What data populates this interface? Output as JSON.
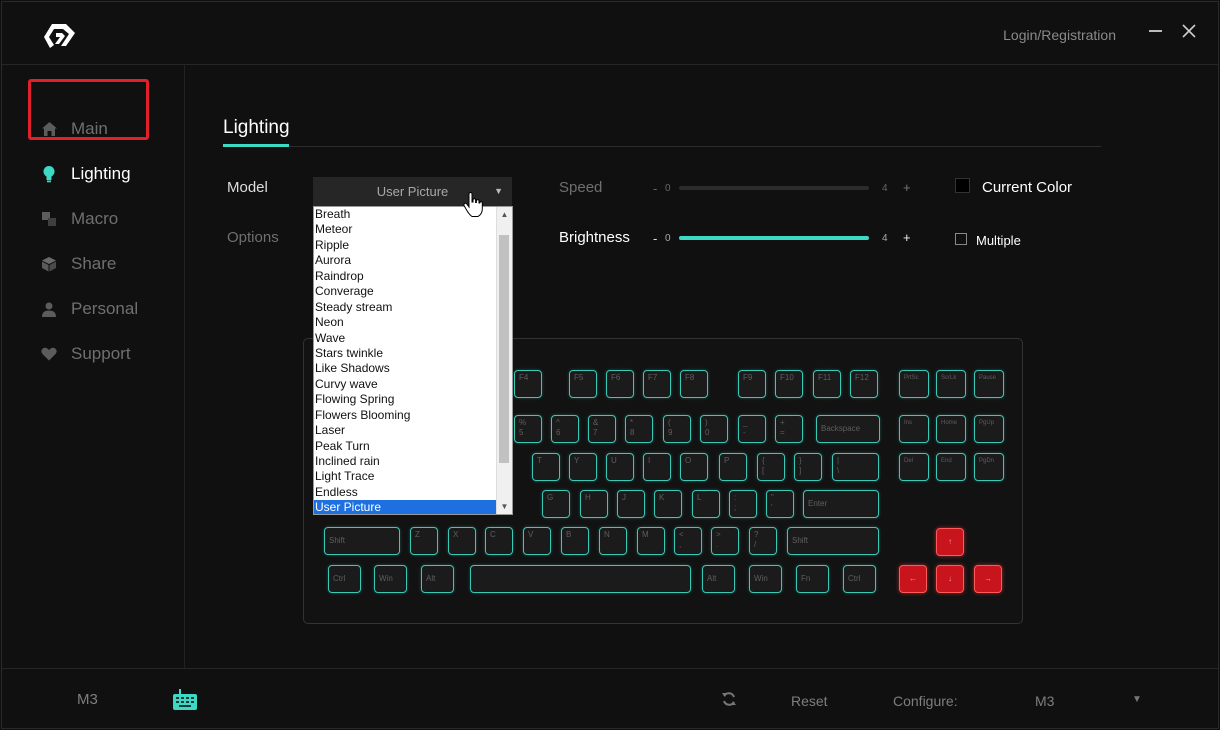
{
  "header": {
    "login_label": "Login/Registration"
  },
  "sidebar": {
    "items": [
      {
        "label": "Main",
        "icon": "home-icon"
      },
      {
        "label": "Lighting",
        "icon": "lightbulb-icon"
      },
      {
        "label": "Macro",
        "icon": "macro-icon"
      },
      {
        "label": "Share",
        "icon": "cube-icon"
      },
      {
        "label": "Personal",
        "icon": "person-icon"
      },
      {
        "label": "Support",
        "icon": "heart-icon"
      }
    ],
    "active": "Lighting"
  },
  "content": {
    "title": "Lighting",
    "model_label": "Model",
    "options_label": "Options",
    "model_selected": "User Picture",
    "model_options": [
      "Breath",
      "Meteor",
      "Ripple",
      "Aurora",
      "Raindrop",
      "Converage",
      "Steady stream",
      "Neon",
      "Wave",
      "Stars twinkle",
      "Like Shadows",
      "Curvy wave",
      "Flowing Spring",
      "Flowers Blooming",
      "Laser",
      "Peak Turn",
      "Inclined rain",
      "Light Trace",
      "Endless",
      "User Picture"
    ],
    "speed": {
      "label": "Speed",
      "minus": "-",
      "plus": "+",
      "min": "0",
      "max": "4",
      "value": 0
    },
    "brightness": {
      "label": "Brightness",
      "minus": "-",
      "plus": "+",
      "min": "0",
      "max": "4",
      "value": 4
    },
    "current_color_label": "Current Color",
    "current_color": "#000000",
    "multiple_label": "Multiple",
    "accent_color": "#3dd9c5",
    "key_highlight_color": "#c8141c"
  },
  "keyboard": {
    "keys": {
      "f4": "F4",
      "f5": "F5",
      "f6": "F6",
      "f7": "F7",
      "f8": "F8",
      "f9": "F9",
      "f10": "F10",
      "f11": "F11",
      "f12": "F12",
      "prtsc": "PrtSc",
      "scrlk": "ScrLk",
      "pause": "Pause",
      "num5": "%\n5",
      "num6": "^\n6",
      "num7": "&\n7",
      "num8": "*\n8",
      "num9": "(\n9",
      "num0": ")\n0",
      "minus": "_\n-",
      "equal": "+\n=",
      "backspace": "Backspace",
      "ins": "Ins",
      "home": "Home",
      "pgup": "PgUp",
      "t": "T",
      "y": "Y",
      "u": "U",
      "i": "I",
      "o": "O",
      "p": "P",
      "lbracket": "{\n[",
      "rbracket": "}\n]",
      "backslash": "|\n\\",
      "del": "Del",
      "end": "End",
      "pgdn": "PgDn",
      "g": "G",
      "h": "H",
      "j": "J",
      "k": "K",
      "l": "L",
      "semicolon": ":\n;",
      "quote": "\"\n'",
      "enter": "Enter",
      "lshift": "Shift",
      "z": "Z",
      "x": "X",
      "c": "C",
      "v": "V",
      "b": "B",
      "n": "N",
      "m": "M",
      "comma": "<\n,",
      "period": ">\n.",
      "slash": "?\n/",
      "rshift": "Shift",
      "lctrl": "Ctrl",
      "lwin": "Win",
      "lalt": "Alt",
      "space": "",
      "ralt": "Alt",
      "rwin": "Win",
      "fn": "Fn",
      "rctrl": "Ctrl",
      "up": "↑",
      "left": "←",
      "down": "↓",
      "right": "→"
    }
  },
  "footer": {
    "device": "M3",
    "reset_label": "Reset",
    "configure_label": "Configure:",
    "configure_value": "M3"
  }
}
